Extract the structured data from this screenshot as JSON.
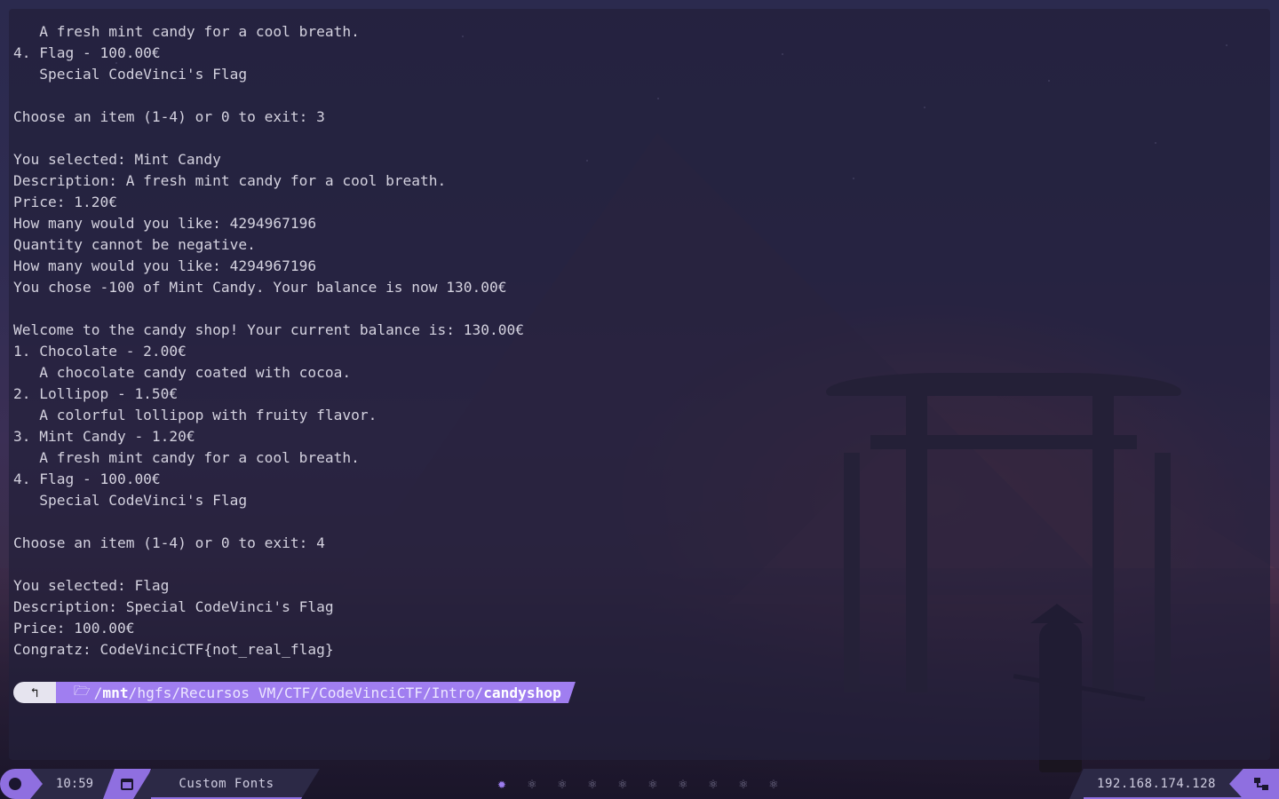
{
  "terminal": {
    "lines": [
      "   A fresh mint candy for a cool breath.",
      "4. Flag - 100.00€",
      "   Special CodeVinci's Flag",
      "",
      "Choose an item (1-4) or 0 to exit: 3",
      "",
      "You selected: Mint Candy",
      "Description: A fresh mint candy for a cool breath.",
      "Price: 1.20€",
      "How many would you like: 4294967196",
      "Quantity cannot be negative.",
      "How many would you like: 4294967196",
      "You chose -100 of Mint Candy. Your balance is now 130.00€",
      "",
      "Welcome to the candy shop! Your current balance is: 130.00€",
      "1. Chocolate - 2.00€",
      "   A chocolate candy coated with cocoa.",
      "2. Lollipop - 1.50€",
      "   A colorful lollipop with fruity flavor.",
      "3. Mint Candy - 1.20€",
      "   A fresh mint candy for a cool breath.",
      "4. Flag - 100.00€",
      "   Special CodeVinci's Flag",
      "",
      "Choose an item (1-4) or 0 to exit: 4",
      "",
      "You selected: Flag",
      "Description: Special CodeVinci's Flag",
      "Price: 100.00€",
      "Congratz: CodeVinciCTF{not_real_flag}"
    ],
    "prompt": {
      "os_icon": "debian-swirl-icon",
      "os_glyph": "↰",
      "folder_icon": "folder-open-icon",
      "folder_glyph": "🗁",
      "path_parts": [
        {
          "text": "/",
          "bold": false
        },
        {
          "text": "mnt",
          "bold": true
        },
        {
          "text": "/hgfs/Recursos VM/CTF/CodeVinciCTF/Intro/",
          "bold": false
        },
        {
          "text": "candyshop",
          "bold": true
        }
      ]
    }
  },
  "statusbar": {
    "clock_icon": "clock-icon",
    "time": "10:59",
    "calendar_icon": "calendar-icon",
    "fonts_label": "Custom Fonts",
    "workspaces": {
      "icon": "react-atom-icon",
      "glyph": "⚛",
      "active_glyph": "✹",
      "count": 10,
      "active_index": 0
    },
    "ip": "192.168.174.128",
    "network_icon": "network-icon"
  },
  "colors": {
    "accent": "#8f6fe0",
    "prompt_path_bg": "#a07ef0",
    "text": "#d4d2df",
    "statusbar_bg": "#2c2946"
  }
}
